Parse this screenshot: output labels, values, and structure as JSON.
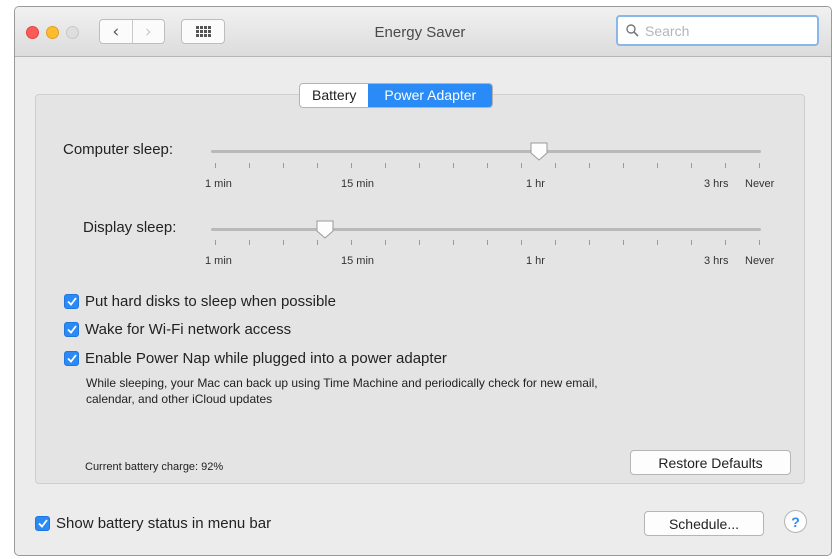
{
  "window": {
    "title": "Energy Saver"
  },
  "search": {
    "placeholder": "Search"
  },
  "tabs": [
    {
      "label": "Battery",
      "active": false
    },
    {
      "label": "Power Adapter",
      "active": true
    }
  ],
  "computer_sleep": {
    "label": "Computer sleep:",
    "tick_labels": [
      "1 min",
      "15 min",
      "1 hr",
      "3 hrs",
      "Never"
    ],
    "value": "1 hr"
  },
  "display_sleep": {
    "label": "Display sleep:",
    "tick_labels": [
      "1 min",
      "15 min",
      "1 hr",
      "3 hrs",
      "Never"
    ],
    "value": "15 min"
  },
  "options": [
    {
      "label": "Put hard disks to sleep when possible",
      "checked": true
    },
    {
      "label": "Wake for Wi-Fi network access",
      "checked": true
    },
    {
      "label": "Enable Power Nap while plugged into a power adapter",
      "checked": true
    }
  ],
  "power_nap_description_line1": "While sleeping, your Mac can back up using Time Machine and periodically check for new email,",
  "power_nap_description_line2": "calendar, and other iCloud updates",
  "battery_charge": "Current battery charge: 92%",
  "buttons": {
    "restore_defaults": "Restore Defaults",
    "schedule": "Schedule...",
    "help": "?"
  },
  "show_battery_status": {
    "label": "Show battery status in menu bar",
    "checked": true
  },
  "colors": {
    "accent": "#2a8af6",
    "close": "#fc5b57",
    "minimize": "#fdbc2e"
  },
  "icons": [
    "back-chevron-icon",
    "forward-chevron-icon",
    "grid-icon",
    "search-icon",
    "checkmark-icon"
  ]
}
